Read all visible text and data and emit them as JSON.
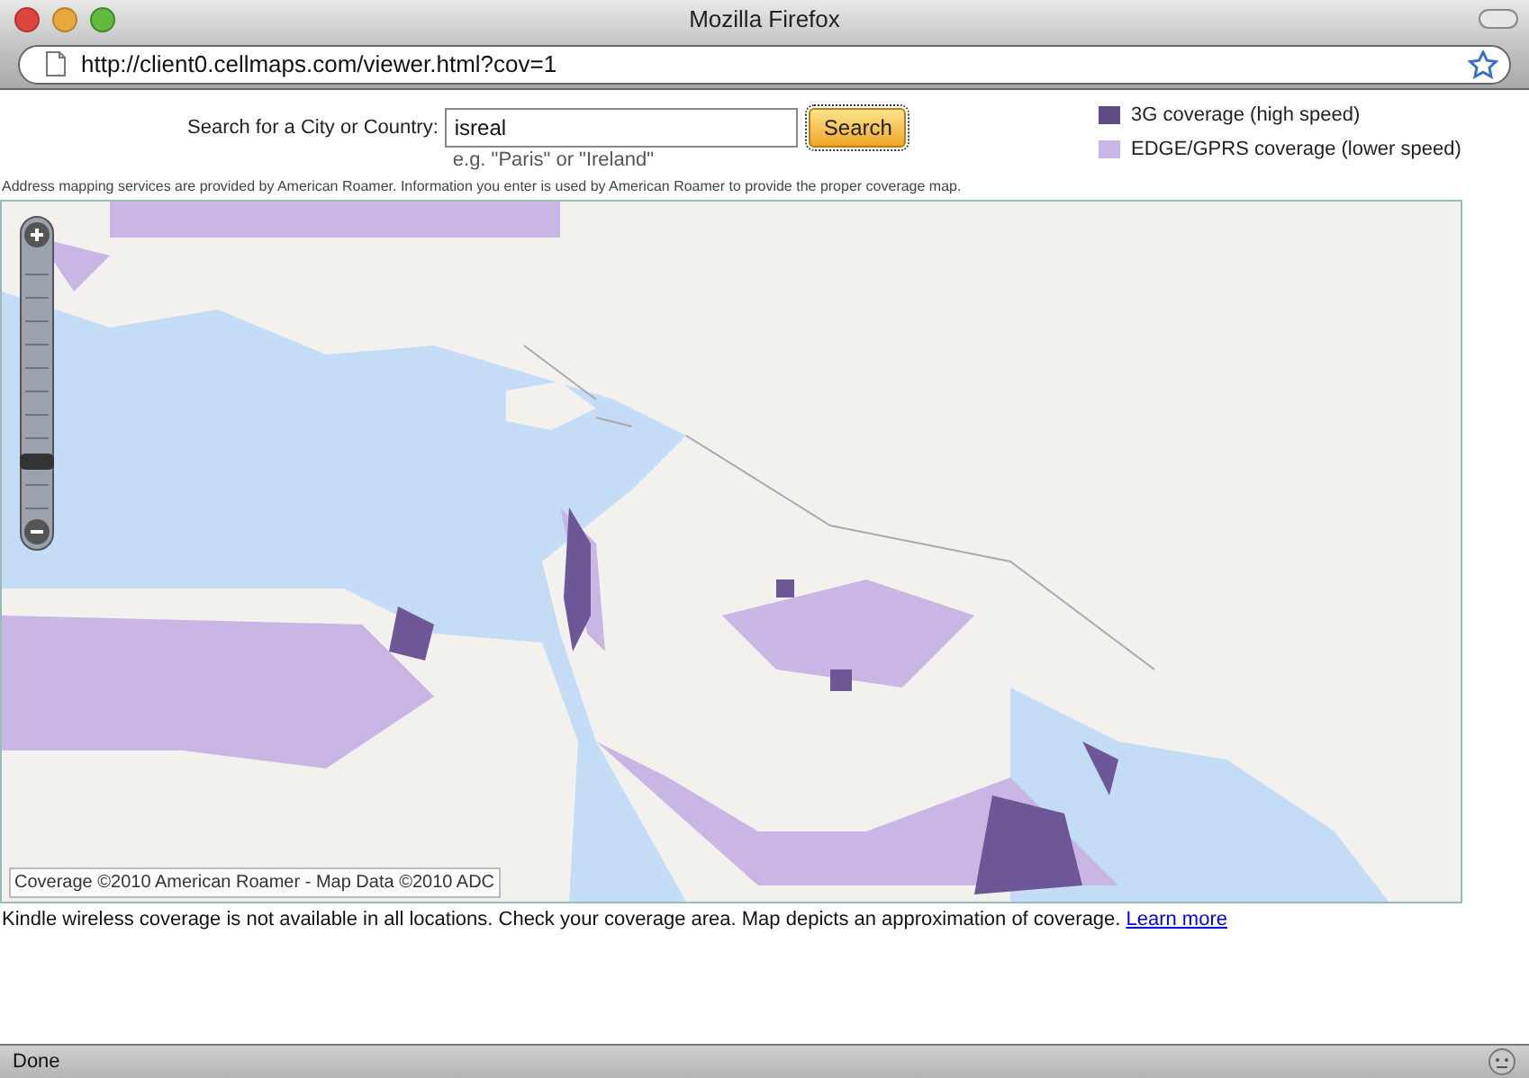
{
  "window": {
    "title": "Mozilla Firefox"
  },
  "address_bar": {
    "url": "http://client0.cellmaps.com/viewer.html?cov=1"
  },
  "search": {
    "label": "Search for a City or Country:",
    "value": "isreal",
    "hint": "e.g. \"Paris\" or \"Ireland\"",
    "button": "Search"
  },
  "legend": [
    {
      "label": "3G coverage (high speed)",
      "color": "#5e4a85"
    },
    {
      "label": "EDGE/GPRS coverage (lower speed)",
      "color": "#c9b6e4"
    }
  ],
  "notice": "Address mapping services are provided by American Roamer. Information you enter is used by American Roamer to provide the proper coverage map.",
  "map": {
    "zoom_slider": {
      "level": 0.2
    },
    "copyright": "Coverage ©2010 American Roamer - Map Data ©2010 ADC"
  },
  "footer": {
    "text": "Kindle wireless coverage is not available in all locations. Check your coverage area. Map depicts an approximation of coverage.",
    "link": "Learn more"
  },
  "status_bar": {
    "text": "Done"
  }
}
